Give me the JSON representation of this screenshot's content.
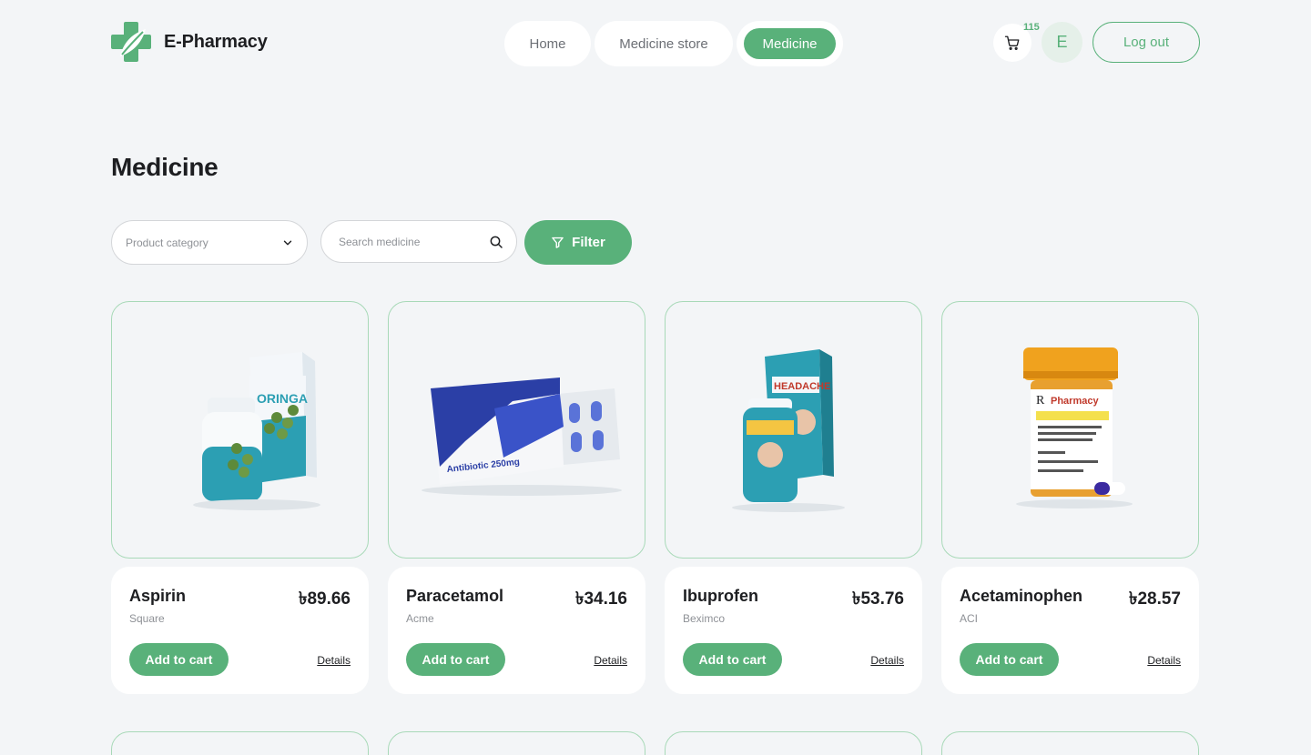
{
  "brand": {
    "name": "E-Pharmacy",
    "logo_icon": "cross-leaf-icon",
    "accent": "#59b17a"
  },
  "nav": {
    "items": [
      {
        "label": "Home"
      },
      {
        "label": "Medicine store"
      },
      {
        "label": "Medicine",
        "active": true
      }
    ]
  },
  "header": {
    "cart_icon": "cart-icon",
    "cart_count": "115",
    "avatar_initial": "E",
    "logout_label": "Log out"
  },
  "page": {
    "title": "Medicine"
  },
  "filters": {
    "category_placeholder": "Product category",
    "search_placeholder": "Search medicine",
    "filter_label": "Filter"
  },
  "products": [
    {
      "name": "Aspirin",
      "price": "৳89.66",
      "brand": "Square",
      "add_label": "Add to cart",
      "details_label": "Details",
      "image": "moringa-supplement-pack"
    },
    {
      "name": "Paracetamol",
      "price": "৳34.16",
      "brand": "Acme",
      "add_label": "Add to cart",
      "details_label": "Details",
      "image": "antibiotic-blister-box",
      "image_text": "Antibiotic 250mg"
    },
    {
      "name": "Ibuprofen",
      "price": "৳53.76",
      "brand": "Beximco",
      "add_label": "Add to cart",
      "details_label": "Details",
      "image": "headache-relief-pack",
      "image_text": "HEADACHE"
    },
    {
      "name": "Acetaminophen",
      "price": "৳28.57",
      "brand": "ACI",
      "add_label": "Add to cart",
      "details_label": "Details",
      "image": "prescription-pill-bottle",
      "image_text": "Pharmacy"
    }
  ]
}
